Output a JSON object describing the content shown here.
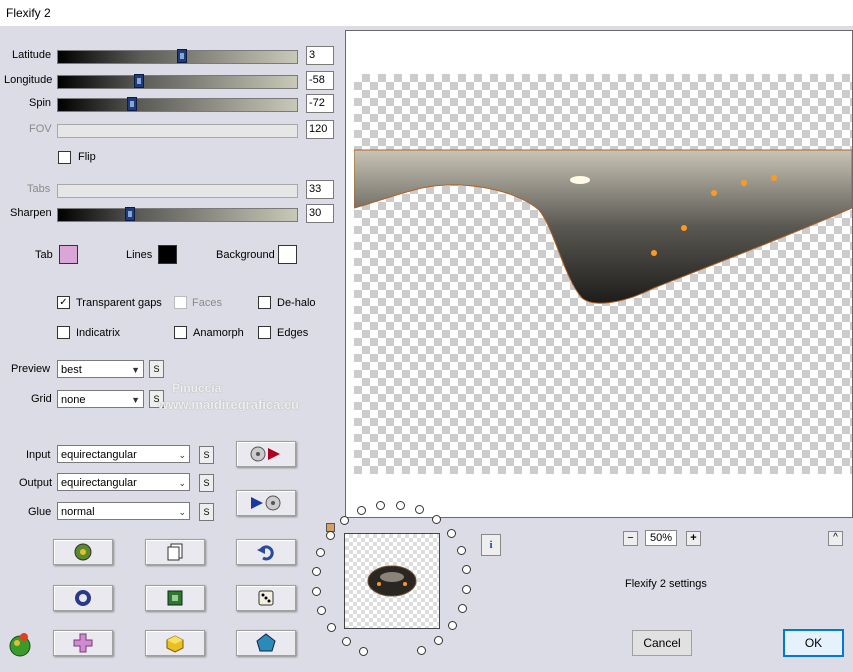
{
  "window": {
    "title": "Flexify 2"
  },
  "sliders": [
    {
      "label": "Latitude",
      "value": "3",
      "position": 0.52,
      "enabled": true
    },
    {
      "label": "Longitude",
      "value": "-58",
      "position": 0.34,
      "enabled": true
    },
    {
      "label": "Spin",
      "value": "-72",
      "position": 0.31,
      "enabled": true
    },
    {
      "label": "FOV",
      "value": "120",
      "position": 0.0,
      "enabled": false
    },
    {
      "label": "Tabs",
      "value": "33",
      "position": 0.0,
      "enabled": false
    },
    {
      "label": "Sharpen",
      "value": "30",
      "position": 0.3,
      "enabled": true
    }
  ],
  "flip": {
    "label": "Flip",
    "checked": false
  },
  "colors": {
    "tab": {
      "label": "Tab",
      "color": "#d9a6d6"
    },
    "lines": {
      "label": "Lines",
      "color": "#000000"
    },
    "background": {
      "label": "Background",
      "color": "#ffffff"
    }
  },
  "options": {
    "transparent_gaps": {
      "label": "Transparent gaps",
      "checked": "✓"
    },
    "faces": {
      "label": "Faces",
      "checked": ""
    },
    "dehalo": {
      "label": "De-halo",
      "checked": ""
    },
    "indicatrix": {
      "label": "Indicatrix",
      "checked": ""
    },
    "anamorph": {
      "label": "Anamorph",
      "checked": ""
    },
    "edges": {
      "label": "Edges",
      "checked": ""
    }
  },
  "preview_select": {
    "label": "Preview",
    "value": "best"
  },
  "grid_select": {
    "label": "Grid",
    "value": "none"
  },
  "watermark": {
    "line1": "Pinuccia",
    "line2": "www.maidiregrafica.eu"
  },
  "input_select": {
    "label": "Input",
    "value": "equirectangular"
  },
  "output_select": {
    "label": "Output",
    "value": "equirectangular"
  },
  "glue_select": {
    "label": "Glue",
    "value": "normal"
  },
  "s_label": "S",
  "zoom": {
    "minus": "−",
    "value": "50%",
    "plus": "+"
  },
  "collapse": "^",
  "info": "i",
  "settings_label": "Flexify 2 settings",
  "buttons": {
    "cancel": "Cancel",
    "ok": "OK"
  }
}
